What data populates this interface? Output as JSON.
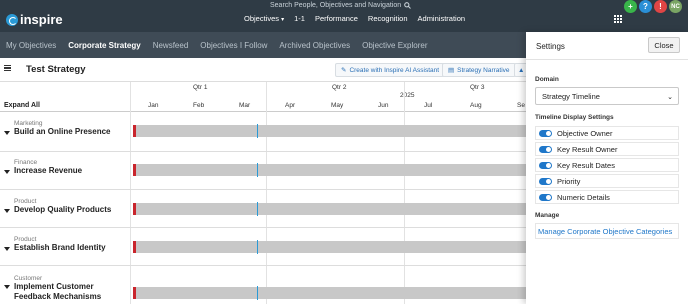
{
  "topbar": {
    "search_placeholder": "Search People, Objectives and Navigation",
    "logo_text": "inspire",
    "nav": [
      "Objectives",
      "1-1",
      "Performance",
      "Recognition",
      "Administration"
    ],
    "objectives_caret": "▾",
    "icons": {
      "add": "+",
      "help": "?",
      "alert": "!",
      "avatar": "NC"
    }
  },
  "subnav": {
    "tabs": [
      "My Objectives",
      "Corporate Strategy",
      "Newsfeed",
      "Objectives I Follow",
      "Archived Objectives",
      "Objective Explorer"
    ],
    "active": "Corporate Strategy"
  },
  "strategy": {
    "title": "Test Strategy",
    "ai_button": "Create with Inspire AI Assistant",
    "narrative_button": "Strategy Narrative"
  },
  "timeline": {
    "expand_all": "Expand All",
    "year": "2025",
    "quarters": [
      "Qtr 1",
      "Qtr 2",
      "Qtr 3"
    ],
    "months": [
      "Jan",
      "Feb",
      "Mar",
      "Apr",
      "May",
      "Jun",
      "Jul",
      "Aug",
      "Se"
    ]
  },
  "objectives": [
    {
      "category": "Marketing",
      "name": "Build an Online Presence"
    },
    {
      "category": "Finance",
      "name": "Increase Revenue"
    },
    {
      "category": "Product",
      "name": "Develop Quality Products"
    },
    {
      "category": "Product",
      "name": "Establish Brand Identity"
    },
    {
      "category": "Customer",
      "name": "Implement Customer Feedback Mechanisms"
    }
  ],
  "settings": {
    "title": "Settings",
    "close": "Close",
    "domain_label": "Domain",
    "domain_value": "Strategy Timeline",
    "timeline_label": "Timeline Display Settings",
    "toggles": [
      "Objective Owner",
      "Key Result Owner",
      "Key Result Dates",
      "Priority",
      "Numeric Details"
    ],
    "manage_label": "Manage",
    "manage_link": "Manage Corporate Objective Categories"
  },
  "colors": {
    "topbar": "#2f3b45",
    "subnav": "#3f4b56",
    "accent": "#1f77c9",
    "bar": "#c8c8c8",
    "start_marker": "#c9252c"
  }
}
